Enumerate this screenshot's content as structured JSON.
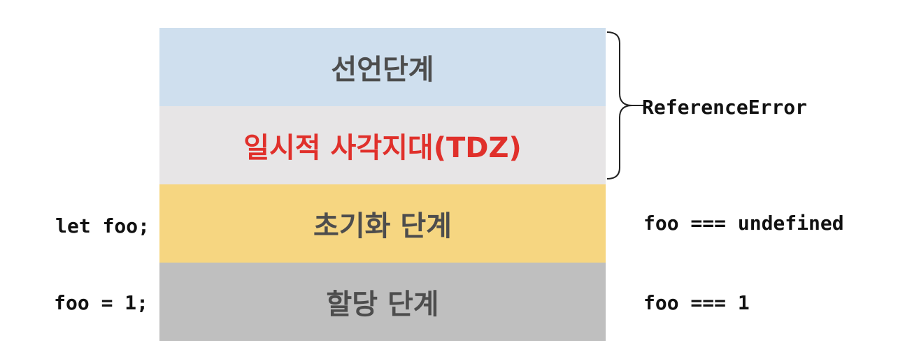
{
  "phases": [
    {
      "label": "선언단계"
    },
    {
      "label": "일시적 사각지대(TDZ)"
    },
    {
      "label": "초기화 단계"
    },
    {
      "label": "할당 단계"
    }
  ],
  "left_code": {
    "init": "let foo;",
    "assign": "foo = 1;"
  },
  "right_notes": {
    "error": "ReferenceError",
    "init_state": "foo === undefined",
    "assign_state": "foo === 1"
  },
  "colors": {
    "declaration": "#cfdfee",
    "tdz": "#e7e5e6",
    "tdz_text": "#e0302b",
    "initialization": "#f6d681",
    "assignment": "#bfbfbf",
    "band_text": "#4d4d4d"
  }
}
